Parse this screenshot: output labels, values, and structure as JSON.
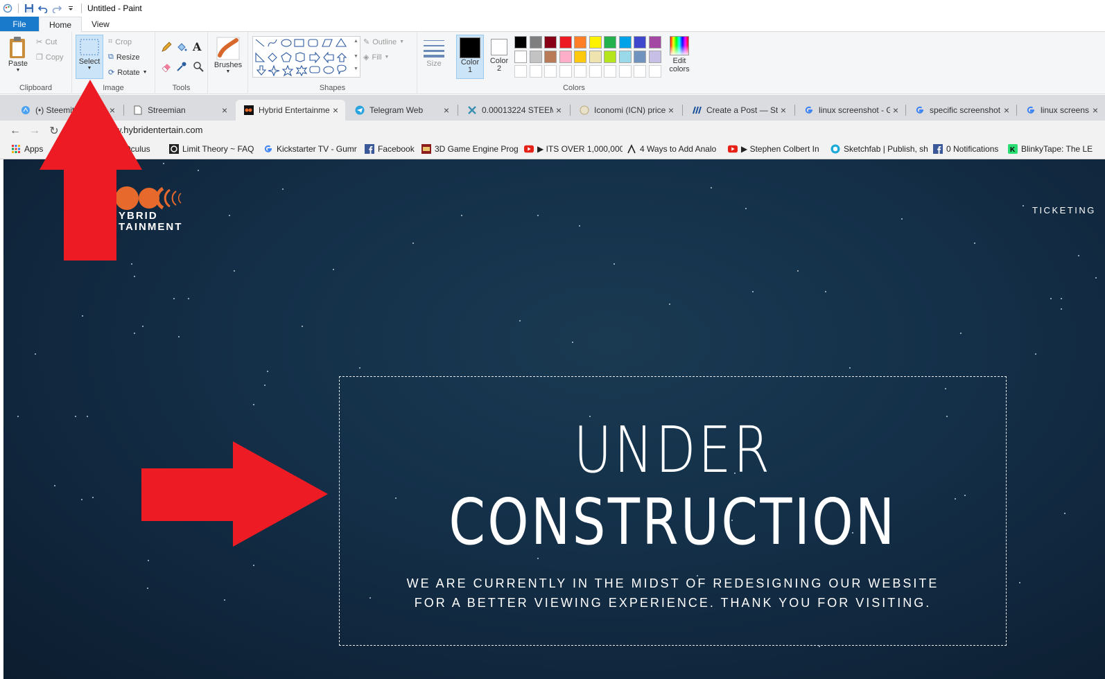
{
  "window": {
    "title": "Untitled - Paint"
  },
  "ribbon_tabs": {
    "file": "File",
    "home": "Home",
    "view": "View"
  },
  "ribbon": {
    "clipboard": {
      "label": "Clipboard",
      "paste": "Paste",
      "cut": "Cut",
      "copy": "Copy"
    },
    "image": {
      "label": "Image",
      "select": "Select",
      "crop": "Crop",
      "resize": "Resize",
      "rotate": "Rotate"
    },
    "tools": {
      "label": "Tools"
    },
    "brushes": {
      "label": "Brushes"
    },
    "shapes": {
      "label": "Shapes",
      "outline": "Outline",
      "fill": "Fill"
    },
    "size": {
      "label": "Size"
    },
    "colors": {
      "label": "Colors",
      "color1_label": "Color",
      "color1_num": "1",
      "color2_label": "Color",
      "color2_num": "2",
      "edit_label1": "Edit",
      "edit_label2": "colors",
      "color1_value": "#000000",
      "color2_value": "#ffffff",
      "palette_row1": [
        "#000000",
        "#7f7f7f",
        "#880015",
        "#ed1c24",
        "#ff7f27",
        "#fff200",
        "#22b14c",
        "#00a2e8",
        "#3f48cc",
        "#a349a4"
      ],
      "palette_row2": [
        "#ffffff",
        "#c3c3c3",
        "#b97a57",
        "#ffaec9",
        "#ffc90e",
        "#efe4b0",
        "#b5e61d",
        "#99d9ea",
        "#7092be",
        "#c8bfe7"
      ]
    }
  },
  "browser": {
    "tabs": [
      {
        "title": "(•) Steemit",
        "icon": "steemit-icon"
      },
      {
        "title": "Streemian",
        "icon": "page-icon"
      },
      {
        "title": "Hybrid Entertainme",
        "icon": "hybrid-icon",
        "active": true
      },
      {
        "title": "Telegram Web",
        "icon": "telegram-icon"
      },
      {
        "title": "0.00013224 STEEM",
        "icon": "exchange-icon"
      },
      {
        "title": "Iconomi (ICN) price",
        "icon": "coin-icon"
      },
      {
        "title": "Create a Post — Ste",
        "icon": "steem-icon"
      },
      {
        "title": "linux screenshot - G",
        "icon": "google-icon"
      },
      {
        "title": "specific screenshot",
        "icon": "google-icon"
      },
      {
        "title": "linux screens",
        "icon": "google-icon"
      }
    ],
    "url": "w.hybridentertain.com",
    "bookmarks": [
      {
        "label": "Apps",
        "icon": "apps-icon"
      },
      {
        "label": "s Oculus",
        "icon": "page-icon"
      },
      {
        "label": "Limit Theory ~ FAQ",
        "icon": "limit-theory-icon"
      },
      {
        "label": "Kickstarter TV - Gumr",
        "icon": "google-icon"
      },
      {
        "label": "Facebook",
        "icon": "facebook-icon"
      },
      {
        "label": "3D Game Engine Prog",
        "icon": "game-icon"
      },
      {
        "label": "▶ ITS OVER 1,000,000",
        "icon": "youtube-icon"
      },
      {
        "label": "4 Ways to Add Analo",
        "icon": "wikihow-icon"
      },
      {
        "label": "▶ Stephen Colbert In",
        "icon": "youtube-icon"
      },
      {
        "label": "Sketchfab | Publish, sh",
        "icon": "sketchfab-icon"
      },
      {
        "label": "0 Notifications",
        "icon": "facebook-icon"
      },
      {
        "label": "BlinkyTape: The LE",
        "icon": "kickstarter-icon"
      }
    ]
  },
  "site": {
    "logo_line1": "YBRID",
    "logo_line2": "TAINMENT",
    "nav_ticketing": "TICKETING",
    "heading_line1": "UNDER",
    "heading_line2": "CONSTRUCTION",
    "sub_line1": "WE ARE CURRENTLY IN THE MIDST OF REDESIGNING OUR WEBSITE",
    "sub_line2": "FOR A BETTER VIEWING EXPERIENCE. THANK YOU FOR VISITING."
  },
  "annotations": {
    "arrow_color": "#ed1c24"
  }
}
